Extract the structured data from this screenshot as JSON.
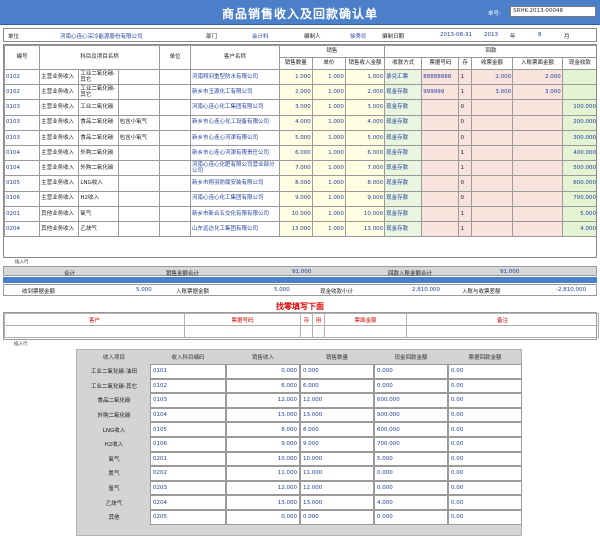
{
  "header": {
    "title": "商品销售收入及回款确认单",
    "doc_no_label": "单号:",
    "doc_no": "SRHK-2013-00048"
  },
  "info": {
    "unit_label": "单位",
    "unit_value": "河南心连心深冷能源股份有限公司",
    "dept_label": "部门",
    "dept_value": "会计科",
    "maker_label": "编制人",
    "maker_value": "徐秀珍",
    "date_label": "编制日期",
    "date_value": "2013-08-31",
    "year": "2013",
    "year_label": "年",
    "month": "8",
    "month_label": "月"
  },
  "grid": {
    "headers": {
      "code": "编号",
      "item_name": "科目及项目名称",
      "unit": "单位",
      "customer": "客户名称",
      "sales": "销售",
      "sales_qty": "销售数量",
      "price": "单价",
      "sales_income": "销售收入金额",
      "payment": "回款",
      "pay_method": "收款方式",
      "ticket_no": "票据号码",
      "stock": "存",
      "receive_amount": "收票金额",
      "bank_in": "入账票面金额",
      "cash_amount": "现金收款"
    },
    "rows": [
      {
        "code": "0102",
        "subject": "主营业务收入",
        "item": "工业二氧化碳-其它",
        "spec": "",
        "unit": "",
        "customer": "河南翔羽重型防水有限公司",
        "qty": "1.000",
        "price": "1.000",
        "income": "1.000",
        "method": "承兑汇票",
        "ticket": "88888888",
        "stock": "1",
        "recv": "2.000",
        "bank": "2.000",
        "cash": ""
      },
      {
        "code": "0102",
        "subject": "主营业务收入",
        "item": "工业二氧化碳-其它",
        "spec": "",
        "unit": "",
        "customer": "新乡市玉源化工有限公司",
        "qty": "2.000",
        "price": "1.000",
        "income": "2.000",
        "method": "现金存款",
        "ticket": "999999",
        "stock": "1",
        "recv": "3.000",
        "bank": "3.000",
        "cash": ""
      },
      {
        "code": "0103",
        "subject": "主营业务收入",
        "item": "工业二氧化碳",
        "spec": "",
        "unit": "",
        "customer": "河南心连心化工集团有限公司",
        "qty": "3.000",
        "price": "1.000",
        "income": "3.000",
        "method": "现金存款",
        "ticket": "",
        "stock": "0",
        "recv": "",
        "bank": "",
        "cash": "100.000"
      },
      {
        "code": "0103",
        "subject": "主营业务收入",
        "item": "食品二氧化碳",
        "spec": "包含小氧气",
        "unit": "",
        "customer": "新乡市心连心化工设备有限公司",
        "qty": "4.000",
        "price": "1.000",
        "income": "4.000",
        "method": "现金存款",
        "ticket": "",
        "stock": "0",
        "recv": "",
        "bank": "",
        "cash": "200.000"
      },
      {
        "code": "0103",
        "subject": "主营业务收入",
        "item": "食品二氧化碳",
        "spec": "包含小氧气",
        "unit": "",
        "customer": "新乡市心连心河津有限公司",
        "qty": "5.000",
        "price": "1.000",
        "income": "5.000",
        "method": "现金存款",
        "ticket": "",
        "stock": "0",
        "recv": "",
        "bank": "",
        "cash": "300.000"
      },
      {
        "code": "0104",
        "subject": "主营业务收入",
        "item": "外购二氧化碳",
        "spec": "",
        "unit": "",
        "customer": "新乡市心连心河津有限责任公司",
        "qty": "6.000",
        "price": "1.000",
        "income": "6.000",
        "method": "现金存款",
        "ticket": "",
        "stock": "1",
        "recv": "",
        "bank": "",
        "cash": "400.000"
      },
      {
        "code": "0104",
        "subject": "主营业务收入",
        "item": "外购二氧化碳",
        "spec": "",
        "unit": "",
        "customer": "河南心连心化肥有限公司营业部分公司",
        "qty": "7.000",
        "price": "1.000",
        "income": "7.000",
        "method": "现金存款",
        "ticket": "",
        "stock": "1",
        "recv": "",
        "bank": "",
        "cash": "500.000"
      },
      {
        "code": "0105",
        "subject": "主营业务收入",
        "item": "LNG收入",
        "spec": "",
        "unit": "",
        "customer": "新乡市翔羽防腐安装有限公司",
        "qty": "8.000",
        "price": "1.000",
        "income": "8.000",
        "method": "现金存款",
        "ticket": "",
        "stock": "0",
        "recv": "",
        "bank": "",
        "cash": "600.000"
      },
      {
        "code": "0106",
        "subject": "主营业务收入",
        "item": "H2收入",
        "spec": "",
        "unit": "",
        "customer": "河南心连心化工集团有限公司",
        "qty": "9.000",
        "price": "1.000",
        "income": "9.000",
        "method": "现金存款",
        "ticket": "",
        "stock": "0",
        "recv": "",
        "bank": "",
        "cash": "700.000"
      },
      {
        "code": "0201",
        "subject": "其他业务收入",
        "item": "氧气",
        "spec": "",
        "unit": "",
        "customer": "新乡市新合五交化有限有限公司",
        "qty": "10.000",
        "price": "1.000",
        "income": "10.000",
        "method": "现金存款",
        "ticket": "",
        "stock": "1",
        "recv": "",
        "bank": "",
        "cash": "5.000"
      },
      {
        "code": "0204",
        "subject": "其他业务收入",
        "item": "乙炔气",
        "spec": "",
        "unit": "",
        "customer": "山东远达化工集团有限公司",
        "qty": "13.000",
        "price": "1.000",
        "income": "13.000",
        "method": "现金存款",
        "ticket": "",
        "stock": "1",
        "recv": "",
        "bank": "",
        "cash": "4.000"
      }
    ],
    "insert_row_label": "插入行"
  },
  "totals": {
    "total_label": "合计",
    "sales_total_label": "销售金额合计",
    "sales_total": "91.000",
    "payment_total_label": "回款入账金额合计",
    "payment_total": "91.000"
  },
  "summary2": {
    "ticket_recv_label": "收到票据金额",
    "ticket_recv": "5.000",
    "ticket_booked_label": "入账票据金额",
    "ticket_booked": "5.000",
    "cash_subtotal_label": "现金收款小计",
    "cash_subtotal": "2,810.000",
    "diff_label": "入账与收票差额",
    "diff": "-2,810.000"
  },
  "ticket_section": {
    "title": "找零填写下面",
    "cols": [
      "客户",
      "票据号码",
      "存",
      "用",
      "票面金额",
      "备注"
    ],
    "insert_row_label": "插入行"
  },
  "bottom": {
    "headers": [
      "收入项目",
      "收入科目编码",
      "销售收入",
      "销售数量",
      "现金回款金额",
      "票据回款金额"
    ],
    "rows": [
      {
        "item": "工业二氧化碳-油田",
        "code": "0101",
        "income": "0.000",
        "qty": "0.000",
        "cash": "0.000",
        "ticket": "0.00"
      },
      {
        "item": "工业二氧化碳-其它",
        "code": "0102",
        "income": "6.000",
        "qty": "6.000",
        "cash": "0.000",
        "ticket": "0.00"
      },
      {
        "item": "食品二氧化碳",
        "code": "0103",
        "income": "12.000",
        "qty": "12.000",
        "cash": "600.000",
        "ticket": "0.00"
      },
      {
        "item": "外购二氧化碳",
        "code": "0104",
        "income": "13.000",
        "qty": "13.000",
        "cash": "900.000",
        "ticket": "0.00"
      },
      {
        "item": "LNG收入",
        "code": "0105",
        "income": "8.000",
        "qty": "8.000",
        "cash": "600.000",
        "ticket": "0.00"
      },
      {
        "item": "H2收入",
        "code": "0106",
        "income": "9.000",
        "qty": "9.000",
        "cash": "700.000",
        "ticket": "0.00"
      },
      {
        "item": "氧气",
        "code": "0201",
        "income": "10.000",
        "qty": "10.000",
        "cash": "5.000",
        "ticket": "0.00"
      },
      {
        "item": "氮气",
        "code": "0202",
        "income": "11.000",
        "qty": "11.000",
        "cash": "0.000",
        "ticket": "0.00"
      },
      {
        "item": "氩气",
        "code": "0203",
        "income": "12.000",
        "qty": "12.000",
        "cash": "0.000",
        "ticket": "0.00"
      },
      {
        "item": "乙炔气",
        "code": "0204",
        "income": "13.000",
        "qty": "13.000",
        "cash": "4.000",
        "ticket": "0.00"
      },
      {
        "item": "其他",
        "code": "0205",
        "income": "0.000",
        "qty": "0.000",
        "cash": "0.000",
        "ticket": "0.00"
      }
    ]
  },
  "colors": {
    "header_blue": "#4b7fc9",
    "yellow": "#fffde2",
    "green": "#e4f4d2",
    "pink": "#f8e4dd",
    "red": "#d00000"
  }
}
